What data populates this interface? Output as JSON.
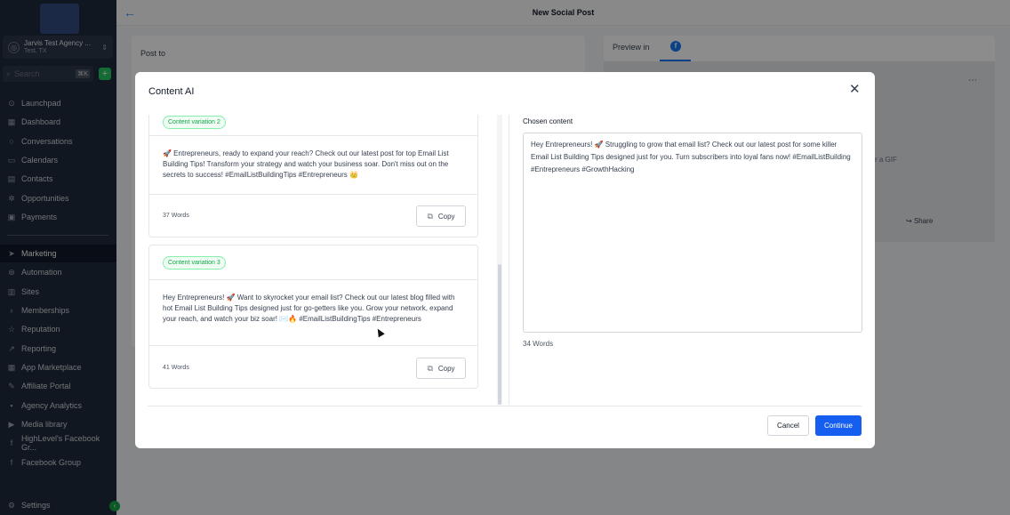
{
  "sidebar": {
    "account": {
      "name": "Jarvis Test Agency ...",
      "location": "Test, TX"
    },
    "search": {
      "placeholder": "Search",
      "shortcut": "⌘K"
    },
    "items": [
      {
        "label": "Launchpad",
        "icon": "rocket-icon"
      },
      {
        "label": "Dashboard",
        "icon": "dashboard-icon"
      },
      {
        "label": "Conversations",
        "icon": "chat-icon"
      },
      {
        "label": "Calendars",
        "icon": "calendar-icon"
      },
      {
        "label": "Contacts",
        "icon": "contacts-icon"
      },
      {
        "label": "Opportunities",
        "icon": "opportunities-icon"
      },
      {
        "label": "Payments",
        "icon": "payments-icon"
      },
      {
        "label": "Marketing",
        "icon": "send-icon",
        "active": true
      },
      {
        "label": "Automation",
        "icon": "automation-icon"
      },
      {
        "label": "Sites",
        "icon": "sites-icon"
      },
      {
        "label": "Memberships",
        "icon": "memberships-icon"
      },
      {
        "label": "Reputation",
        "icon": "star-icon"
      },
      {
        "label": "Reporting",
        "icon": "chart-icon"
      },
      {
        "label": "App Marketplace",
        "icon": "grid-icon"
      },
      {
        "label": "Affiliate Portal",
        "icon": "affiliate-icon"
      },
      {
        "label": "Agency Analytics",
        "icon": "analytics-icon"
      },
      {
        "label": "Media library",
        "icon": "media-icon"
      },
      {
        "label": "HighLevel's Facebook Gr...",
        "icon": "facebook-icon"
      },
      {
        "label": "Facebook Group",
        "icon": "facebook-icon"
      }
    ],
    "settings": "Settings"
  },
  "header": {
    "title": "New Social Post"
  },
  "background": {
    "post_to_label": "Post to",
    "preview_tab": "Preview in",
    "gif_hint": "r a GIF",
    "share_label": "Share"
  },
  "modal": {
    "title": "Content AI",
    "variations": [
      {
        "badge": "Content variation 2",
        "text": "🚀 Entrepreneurs, ready to expand your reach? Check out our latest post for top Email List Building Tips! Transform your strategy and watch your business soar. Don't miss out on the secrets to success! #EmailListBuildingTips #Entrepreneurs 👑",
        "words": "37 Words",
        "copy_label": "Copy"
      },
      {
        "badge": "Content variation 3",
        "text": "Hey Entrepreneurs! 🚀 Want to skyrocket your email list? Check out our latest blog filled with hot Email List Building Tips designed just for go-getters like you. Grow your network, expand your reach, and watch your biz soar! ✉️🔥 #EmailListBuildingTips #Entrepreneurs",
        "words": "41 Words",
        "copy_label": "Copy"
      }
    ],
    "chosen": {
      "label": "Chosen content",
      "text": "Hey Entrepreneurs! 🚀 Struggling to grow that email list? Check out our latest post for some killer Email List Building Tips designed just for you. Turn subscribers into loyal fans now! #EmailListBuilding #Entrepreneurs #GrowthHacking",
      "words": "34 Words"
    },
    "cancel_label": "Cancel",
    "continue_label": "Continue"
  },
  "colors": {
    "primary": "#155eef",
    "badge_green": "#16a34a",
    "sidebar_bg": "#1e2a3b"
  }
}
